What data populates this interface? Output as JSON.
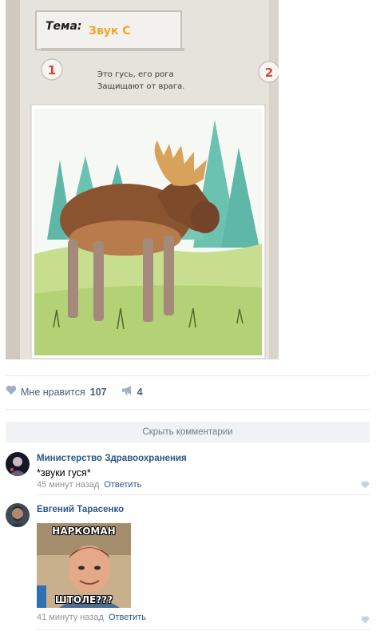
{
  "post": {
    "photo": {
      "topic_label": "Тема:",
      "topic_value": "Звук С",
      "item_number_1": "1",
      "item_number_2": "2",
      "rhyme_line_1": "Это гусь, его рога",
      "rhyme_line_2": "Защищают от врага."
    },
    "actions": {
      "like_label": "Мне нравится",
      "like_count": "107",
      "share_count": "4"
    }
  },
  "comments": {
    "hide_label": "Скрыть комментарии",
    "items": [
      {
        "author": "Министерство Здравоохранения",
        "text": "*звуки гуся*",
        "time": "45 минут назад",
        "reply": "Ответить"
      },
      {
        "author": "Евгений Тарасенко",
        "meme_top": "НАРКОМАН",
        "meme_bottom": "ШТОЛЕ???",
        "time": "41 минуту назад",
        "reply": "Ответить"
      }
    ]
  },
  "colors": {
    "link": "#2a5885",
    "muted": "#939393",
    "action_icon": "#9fb0c4",
    "topic_accent": "#f2a72b"
  },
  "icons": {
    "like": "heart-icon",
    "share": "megaphone-icon"
  }
}
